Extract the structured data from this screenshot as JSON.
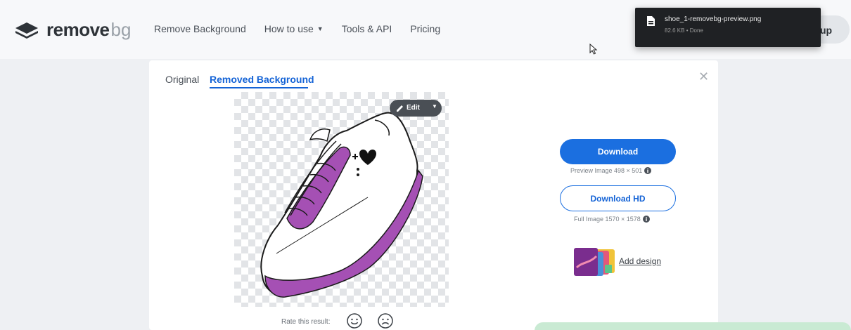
{
  "header": {
    "logo_bold": "remove",
    "logo_light": "bg",
    "nav": [
      {
        "label": "Remove Background"
      },
      {
        "label": "How to use",
        "has_caret": true
      },
      {
        "label": "Tools & API"
      },
      {
        "label": "Pricing"
      }
    ],
    "signup_partial": "up"
  },
  "download_popup": {
    "filename": "shoe_1-removebg-preview.png",
    "meta": "82.6 KB • Done"
  },
  "card": {
    "tabs": [
      {
        "label": "Original",
        "active": false
      },
      {
        "label": "Removed Background",
        "active": true
      }
    ],
    "edit_label": "Edit",
    "download_label": "Download",
    "preview_meta": "Preview Image 498 × 501",
    "download_hd_label": "Download HD",
    "full_meta": "Full Image 1570 × 1578",
    "add_design_label": "Add design",
    "rate_label": "Rate this result:"
  },
  "icons": {
    "close": "close-icon",
    "pencil": "pencil-icon",
    "info": "info-icon",
    "file": "file-icon",
    "happy": "happy-face-icon",
    "sad": "sad-face-icon",
    "cursor": "mouse-cursor-icon"
  },
  "colors": {
    "accent": "#1b6fe0",
    "shoe_accent": "#a550b4",
    "popup_bg": "#1f2124"
  }
}
